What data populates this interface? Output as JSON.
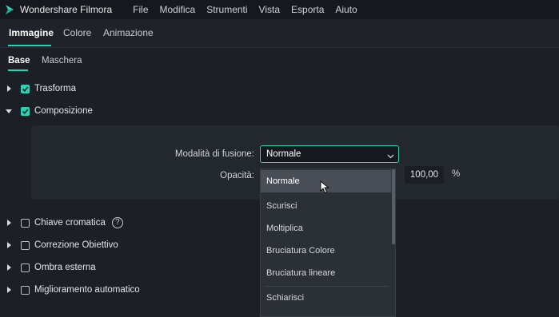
{
  "titlebar": {
    "app_title": "Wondershare Filmora",
    "logo_icon": "filmora-logo-icon",
    "menu": [
      "File",
      "Modifica",
      "Strumenti",
      "Vista",
      "Esporta",
      "Aiuto"
    ]
  },
  "tabs_main": {
    "items": [
      "Immagine",
      "Colore",
      "Animazione"
    ],
    "active": "Immagine"
  },
  "tabs_sub": {
    "items": [
      "Base",
      "Maschera"
    ],
    "active": "Base"
  },
  "sections": [
    {
      "label": "Trasforma",
      "checked": true,
      "expanded": false
    },
    {
      "label": "Composizione",
      "checked": true,
      "expanded": true
    },
    {
      "label": "Chiave cromatica",
      "checked": false,
      "expanded": false,
      "help": "?"
    },
    {
      "label": "Correzione Obiettivo",
      "checked": false,
      "expanded": false
    },
    {
      "label": "Ombra esterna",
      "checked": false,
      "expanded": false
    },
    {
      "label": "Miglioramento automatico",
      "checked": false,
      "expanded": false
    }
  ],
  "composition": {
    "blend_label": "Modalità di fusione:",
    "blend_value": "Normale",
    "opacity_label": "Opacità:",
    "opacity_value": "100,00",
    "opacity_unit": "%"
  },
  "blend_dropdown": {
    "options": [
      "Normale",
      "Scurisci",
      "Moltiplica",
      "Bruciatura Colore",
      "Bruciatura lineare",
      "Schiarisci"
    ],
    "selected": "Normale"
  },
  "colors": {
    "accent": "#2fd1b6",
    "background": "#1c2026",
    "panel": "#23272e",
    "dropdown": "#2b2f36"
  }
}
